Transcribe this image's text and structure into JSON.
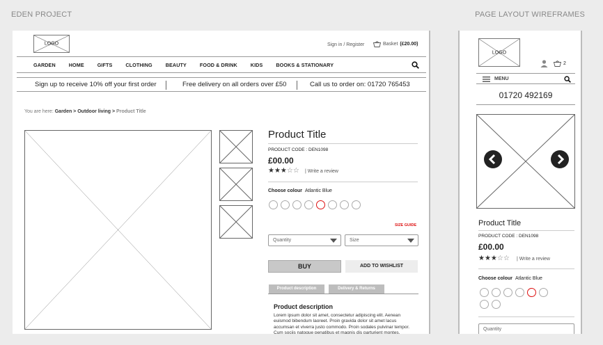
{
  "header": {
    "left": "EDEN PROJECT",
    "right": "PAGE LAYOUT WIREFRAMES"
  },
  "desktop": {
    "logo": "LOGO",
    "signin": "Sign in / Register",
    "basket_label": "Basket",
    "basket_amount": "(£20.00)",
    "nav": [
      "GARDEN",
      "HOME",
      "GIFTS",
      "CLOTHING",
      "BEAUTY",
      "FOOD & DRINK",
      "KIDS",
      "BOOKS & STATIONARY"
    ],
    "promo": {
      "p1": "Sign up to receive 10% off your first order",
      "p2": "Free delivery on all orders over £50",
      "p3": "Call us to order on: 01720 765453"
    },
    "breadcrumb": {
      "prefix": "You are here:",
      "path": "Garden > Outdoor living >",
      "current": "Product Title"
    },
    "product": {
      "title": "Product Title",
      "code": "PRODUCT CODE : DEN1098",
      "price": "£00.00",
      "rating": 3,
      "review_link": "Write a review",
      "choose_label": "Choose colour",
      "colour": "Atlantic Blue",
      "swatch_count": 8,
      "selected_swatch": 4,
      "size_guide": "SIZE GUIDE",
      "quantity_placeholder": "Quantity",
      "size_placeholder": "Size",
      "buy": "BUY",
      "wishlist": "ADD TO WISHLIST",
      "tabs": [
        "Product description",
        "Delivery & Returns"
      ],
      "desc_heading": "Product description",
      "desc_text": "Lorem ipsum dolor sit amet, consectetur adipiscing elit. Aenean euismod bibendum laoreet. Proin gravida dolor sit amet lacus accumsan et viverra justo commodo. Proin sodales pulvinar tempor. Cum sociis natoque penatibus et magnis dis parturient montes, nascetur ridiculus mus."
    }
  },
  "mobile": {
    "logo": "LOGO",
    "basket_count": "2",
    "menu": "MENU",
    "phone": "01720 492169",
    "title": "Product Title",
    "code": "PRODUCT CODE : DEN1098",
    "price": "£00.00",
    "rating": 3,
    "review_link": "Write a review",
    "choose_label": "Choose colour",
    "colour": "Atlantic Blue",
    "swatch_count": 7,
    "selected_swatch": 4,
    "quantity_placeholder": "Quantity"
  },
  "colors": {
    "accent": "#dd1111",
    "buy_bg": "#c8c8c8",
    "tab_bg": "#bdbdbd"
  },
  "icons": [
    "search-icon",
    "basket-icon",
    "user-icon",
    "menu-icon",
    "chevron-left-icon",
    "chevron-right-icon",
    "dropdown-arrow-icon"
  ]
}
